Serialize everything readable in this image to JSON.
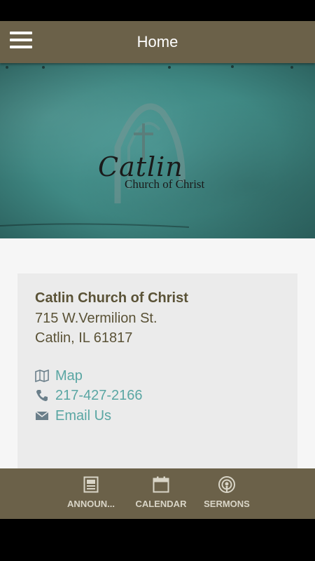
{
  "header": {
    "title": "Home",
    "menu_icon": "hamburger-menu-icon"
  },
  "hero": {
    "logo_wordmark": "Catlin",
    "logo_subtitle": "Church of Christ",
    "background": "#3f8883"
  },
  "contact": {
    "name": "Catlin Church of Christ",
    "address_line1": "715 W.Vermilion St.",
    "address_line2": "Catlin, IL 61817",
    "map_label": "Map",
    "phone_label": "217-427-2166",
    "email_label": "Email Us"
  },
  "tabs": [
    {
      "label": "ANNOUN...",
      "icon": "announcements-icon"
    },
    {
      "label": "CALENDAR",
      "icon": "calendar-icon"
    },
    {
      "label": "SERMONS",
      "icon": "podcast-icon"
    }
  ],
  "colors": {
    "brand": "#6b6149",
    "link": "#5aa6a3",
    "text": "#5a5236"
  }
}
